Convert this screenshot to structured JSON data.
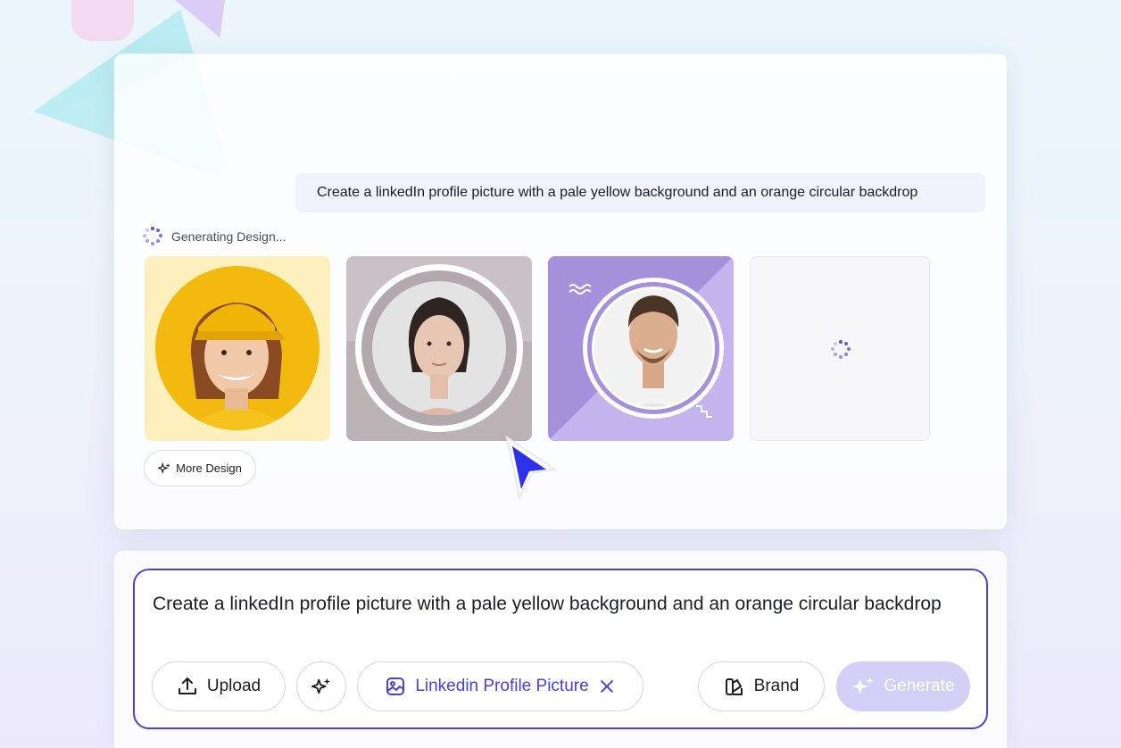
{
  "chat": {
    "user_prompt": "Create a linkedIn profile picture with a pale yellow background and an orange circular backdrop"
  },
  "status": {
    "generating_label": "Generating Design..."
  },
  "designs": [
    {
      "name": "design-yellow",
      "state": "ready"
    },
    {
      "name": "design-gray",
      "state": "ready"
    },
    {
      "name": "design-purple",
      "state": "ready"
    },
    {
      "name": "design-loading",
      "state": "loading"
    }
  ],
  "actions": {
    "more_design_label": "More Design"
  },
  "composer": {
    "input_value": "Create a linkedIn profile picture with a pale yellow background and an orange circular backdrop",
    "upload_label": "Upload",
    "tag_label": "Linkedin Profile Picture",
    "brand_label": "Brand",
    "generate_label": "Generate"
  },
  "colors": {
    "accent": "#4a3fd6",
    "generate_disabled": "#d4cff7",
    "spinner": "#5a4fd8"
  },
  "icons": {
    "upload": "upload-icon",
    "magic": "sparkle-icon",
    "tag": "image-edit-icon",
    "remove": "close-icon",
    "brand": "palette-icon",
    "generate": "sparkle-icon",
    "cursor": "pointer-cursor-icon"
  }
}
